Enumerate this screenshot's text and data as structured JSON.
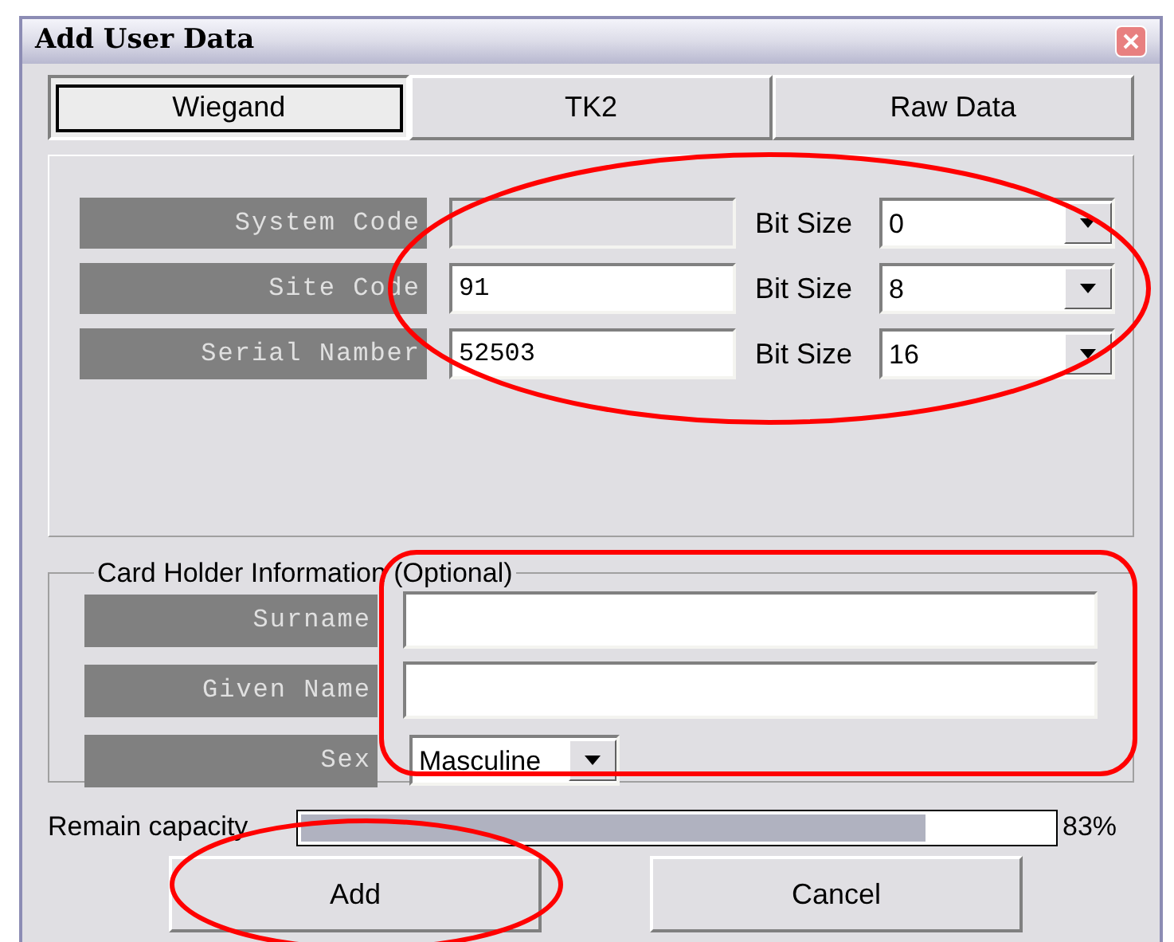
{
  "window": {
    "title": "Add User Data"
  },
  "tabs": [
    {
      "label": "Wiegand",
      "selected": true
    },
    {
      "label": "TK2",
      "selected": false
    },
    {
      "label": "Raw Data",
      "selected": false
    }
  ],
  "wiegand_fields": [
    {
      "label": "System Code",
      "disabled": true,
      "bit_size_label": "Bit Size",
      "bit_size": "0"
    },
    {
      "label": "Site Code",
      "value": "91",
      "disabled": false,
      "bit_size_label": "Bit Size",
      "bit_size": "8"
    },
    {
      "label": "Serial Namber",
      "value": "52503",
      "disabled": false,
      "bit_size_label": "Bit Size",
      "bit_size": "16"
    }
  ],
  "card_holder": {
    "legend": "Card Holder Information (Optional)",
    "fields": [
      {
        "label": "Surname",
        "kind": "text"
      },
      {
        "label": "Given Name",
        "kind": "text"
      },
      {
        "label": "Sex",
        "kind": "combo",
        "value": "Masculine"
      }
    ]
  },
  "capacity": {
    "label": "Remain capacity",
    "level": 0.83,
    "reading": "83%"
  },
  "buttons": [
    "Add",
    "Cancel"
  ]
}
